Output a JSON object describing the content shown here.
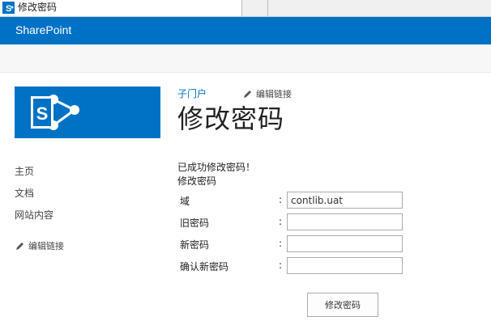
{
  "browser": {
    "tab_title": "修改密码",
    "tab_icon": "sharepoint-icon"
  },
  "suite_bar": {
    "brand": "SharePoint",
    "color": "#0072c6"
  },
  "site": {
    "logo_icon": "sharepoint-logo-icon",
    "breadcrumb_link": "子门户",
    "edit_links_label": "编辑链接",
    "page_title": "修改密码"
  },
  "left_nav": {
    "items": [
      {
        "label": "主页"
      },
      {
        "label": "文档"
      },
      {
        "label": "网站内容"
      }
    ],
    "edit_links_label": "编辑链接"
  },
  "form": {
    "success_message": "已成功修改密码！",
    "heading": "修改密码",
    "fields": [
      {
        "label": "域",
        "colon": ":",
        "value": "contlib.uat"
      },
      {
        "label": "旧密码",
        "colon": ":",
        "value": ""
      },
      {
        "label": "新密码",
        "colon": ":",
        "value": ""
      },
      {
        "label": "确认新密码",
        "colon": ":",
        "value": ""
      }
    ],
    "submit_label": "修改密码"
  }
}
